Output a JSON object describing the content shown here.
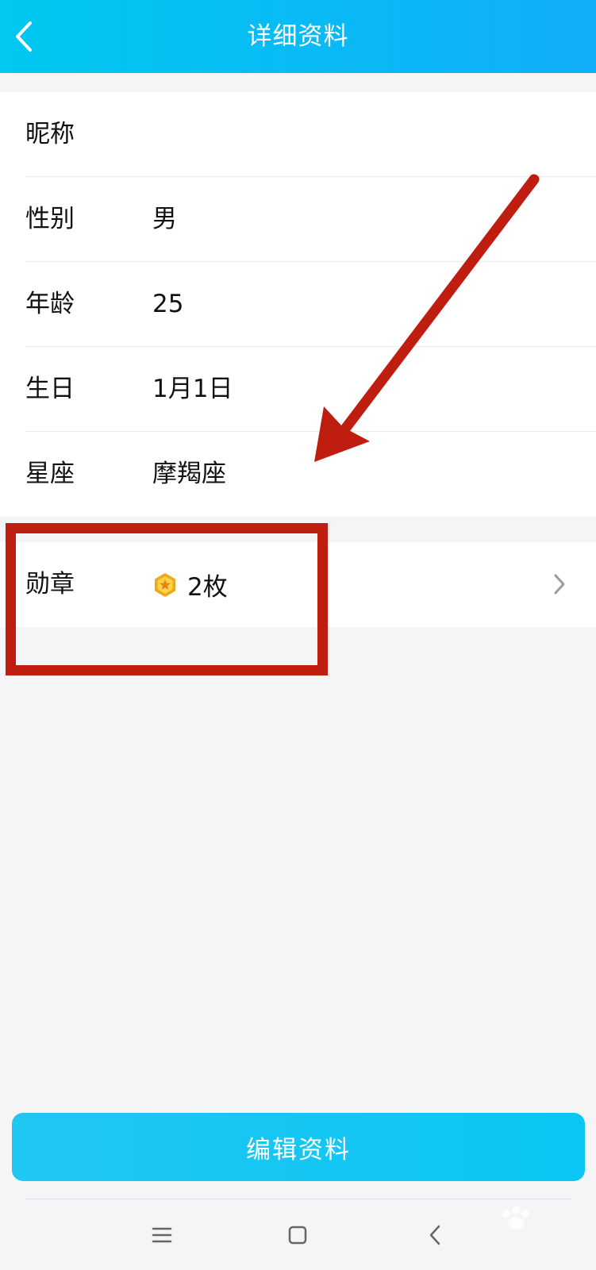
{
  "header": {
    "title": "详细资料",
    "back_icon": "chevron-left-icon"
  },
  "profile": {
    "rows": [
      {
        "label": "昵称",
        "value": ""
      },
      {
        "label": "性别",
        "value": "男"
      },
      {
        "label": "年龄",
        "value": "25"
      },
      {
        "label": "生日",
        "value": "1月1日"
      },
      {
        "label": "星座",
        "value": "摩羯座"
      }
    ]
  },
  "medal": {
    "label": "勋章",
    "icon": "medal-hexagon-star-icon",
    "count": "2枚",
    "chevron_icon": "chevron-right-icon"
  },
  "actions": {
    "edit_label": "编辑资料"
  },
  "nav": {
    "menu_icon": "menu-icon",
    "home_icon": "home-square-icon",
    "back_icon": "back-triangle-icon"
  },
  "annotations": {
    "arrow_color": "#bf1d10",
    "box_color": "#bf1d10"
  },
  "colors": {
    "header_start": "#00c8f0",
    "header_end": "#10aef8",
    "button": "#0ac6f4",
    "background": "#f5f5f8"
  }
}
